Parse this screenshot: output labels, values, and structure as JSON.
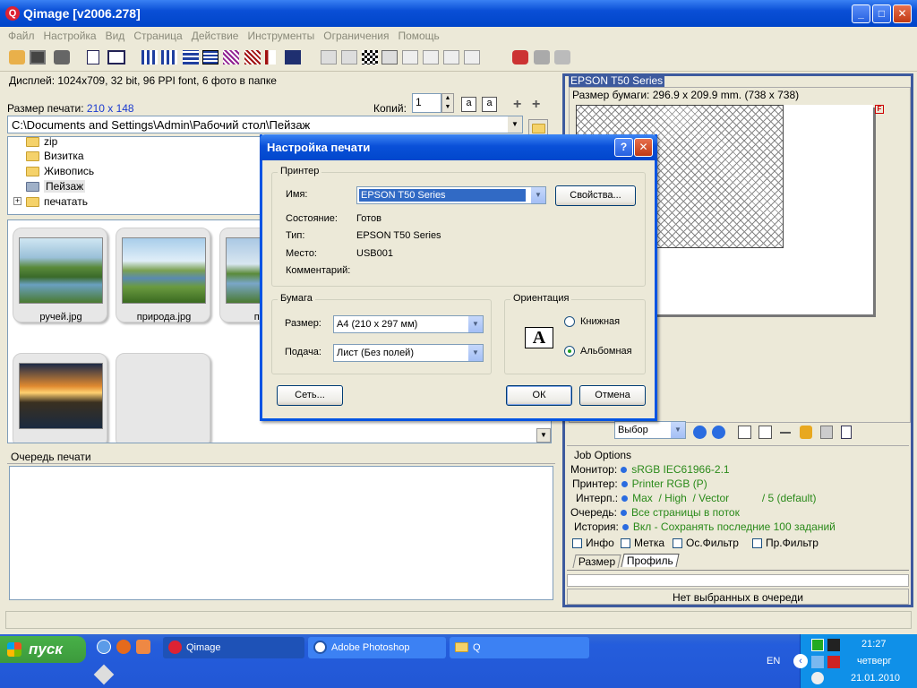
{
  "window": {
    "title": "Qimage [v2006.278]",
    "logo": "Q",
    "min": "_",
    "max": "□",
    "close": "✕"
  },
  "menu": [
    "Файл",
    "Настройка",
    "Вид",
    "Страница",
    "Действие",
    "Инструменты",
    "Ограничения",
    "Помощь"
  ],
  "left": {
    "display_info": "Дисплей: 1024x709, 32 bit, 96 PPI font, 6 фото в папке",
    "print_size_label": "Размер печати:",
    "print_size_value": "210 x 148",
    "copies_label": "Копий:",
    "copies_value": "1",
    "path": "C:\\Documents and Settings\\Admin\\Рабочий стол\\Пейзаж",
    "tree": [
      {
        "label": "zip",
        "expand": ""
      },
      {
        "label": "Визитка",
        "expand": ""
      },
      {
        "label": "Живопись",
        "expand": ""
      },
      {
        "label": "Пейзаж",
        "expand": ""
      },
      {
        "label": "печатать",
        "expand": "+"
      }
    ],
    "thumbnails": [
      {
        "caption": "ручей.jpg"
      },
      {
        "caption": "природа.jpg"
      },
      {
        "caption": "панор"
      },
      {
        "caption": ""
      },
      {
        "caption": ""
      }
    ],
    "queue_title": "Очередь печати"
  },
  "right": {
    "printer_title": "EPSON T50 Series",
    "paper_size": "Размер бумаги: 296.9 x 209.9 mm.  (738 x 738)",
    "select_value": "Выбор",
    "job_options_title": "Job Options",
    "options": [
      {
        "label": "Монитор:",
        "value": "sRGB IEC61966-2.1"
      },
      {
        "label": "Принтер:",
        "value": "Printer RGB (P)"
      },
      {
        "label": "Интерп.:",
        "value": "Max  / High  / Vector           / 5 (default)"
      },
      {
        "label": "Очередь:",
        "value": "Все страницы в поток"
      },
      {
        "label": "История:",
        "value": "Вкл - Сохранять последние 100 заданий"
      }
    ],
    "checkboxes": [
      "Инфо",
      "Метка",
      "Ос.Фильтр",
      "Пр.Фильтр"
    ],
    "tabs": [
      "Размер",
      "Профиль"
    ],
    "status": "Нет выбранных в очереди"
  },
  "dialog": {
    "title": "Настройка печати",
    "help": "?",
    "close": "✕",
    "printer_group": "Принтер",
    "name_label": "Имя:",
    "name_value": "EPSON T50 Series",
    "properties_btn": "Свойства...",
    "status_label": "Состояние:",
    "status_value": "Готов",
    "type_label": "Тип:",
    "type_value": "EPSON T50 Series",
    "where_label": "Место:",
    "where_value": "USB001",
    "comment_label": "Комментарий:",
    "paper_group": "Бумага",
    "size_label": "Размер:",
    "size_value": "A4 (210 x 297 мм)",
    "source_label": "Подача:",
    "source_value": "Лист (Без полей)",
    "orient_group": "Ориентация",
    "portrait": "Книжная",
    "landscape": "Альбомная",
    "orient_icon": "A",
    "network_btn": "Сеть...",
    "ok_btn": "ОК",
    "cancel_btn": "Отмена"
  },
  "taskbar": {
    "start": "пуск",
    "tasks": [
      {
        "label": "Qimage",
        "active": true
      },
      {
        "label": "Adobe Photoshop",
        "active": false
      },
      {
        "label": "Q",
        "active": false
      }
    ],
    "lang": "EN",
    "time": "21:27",
    "weekday": "четверг",
    "date": "21.01.2010"
  }
}
